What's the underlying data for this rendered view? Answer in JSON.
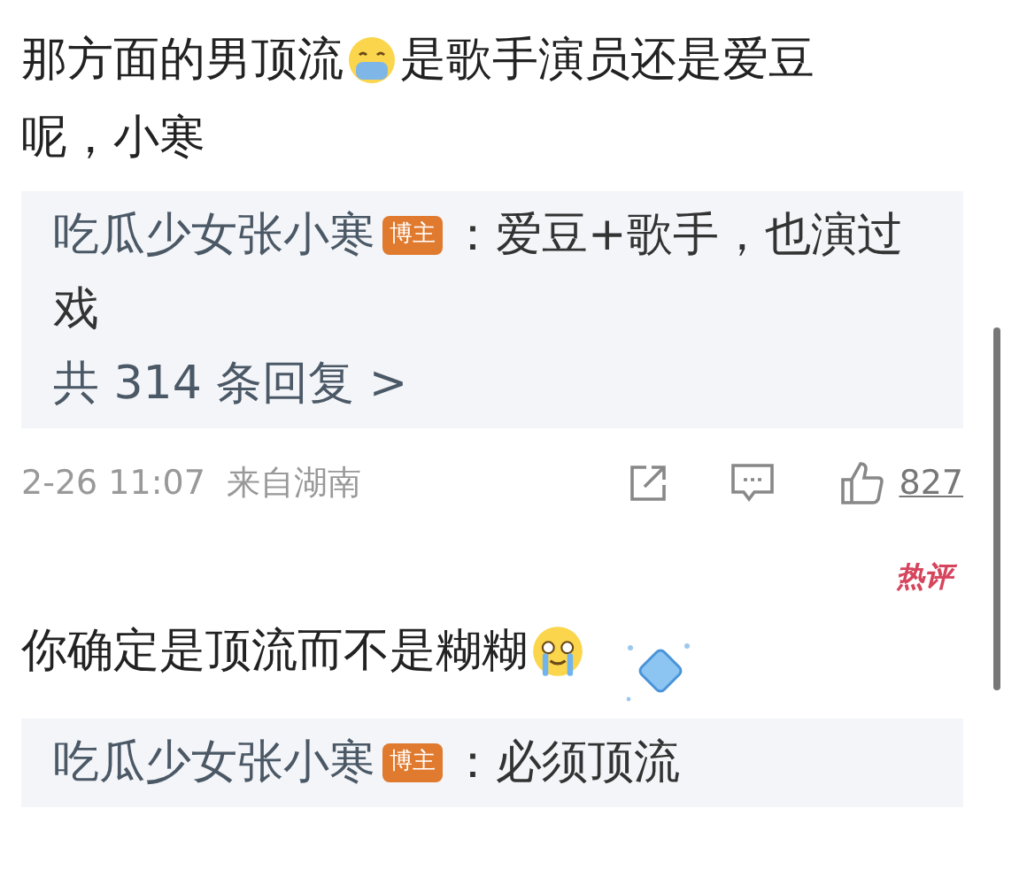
{
  "comments": [
    {
      "text_parts": [
        "那方面的男顶流",
        "是歌手演员还是爱豆",
        "呢，小寒"
      ],
      "emoji": {
        "kind": "mask"
      },
      "sticker": false,
      "reply": {
        "author": "吃瓜少女张小寒",
        "badge": "博主",
        "text_parts": [
          "：爱豆+歌手，也演过",
          "戏"
        ]
      },
      "more_replies": "共 314 条回复 >",
      "meta": {
        "date": "2-26 11:07",
        "location": "来自湖南",
        "likes": "827"
      }
    },
    {
      "hot_tag": "热评",
      "text_parts": [
        "你确定是顶流而不是糊糊"
      ],
      "emoji": {
        "kind": "crying"
      },
      "sticker": true,
      "reply": {
        "author": "吃瓜少女张小寒",
        "badge": "博主",
        "text_parts": [
          "：必须顶流"
        ]
      }
    }
  ]
}
